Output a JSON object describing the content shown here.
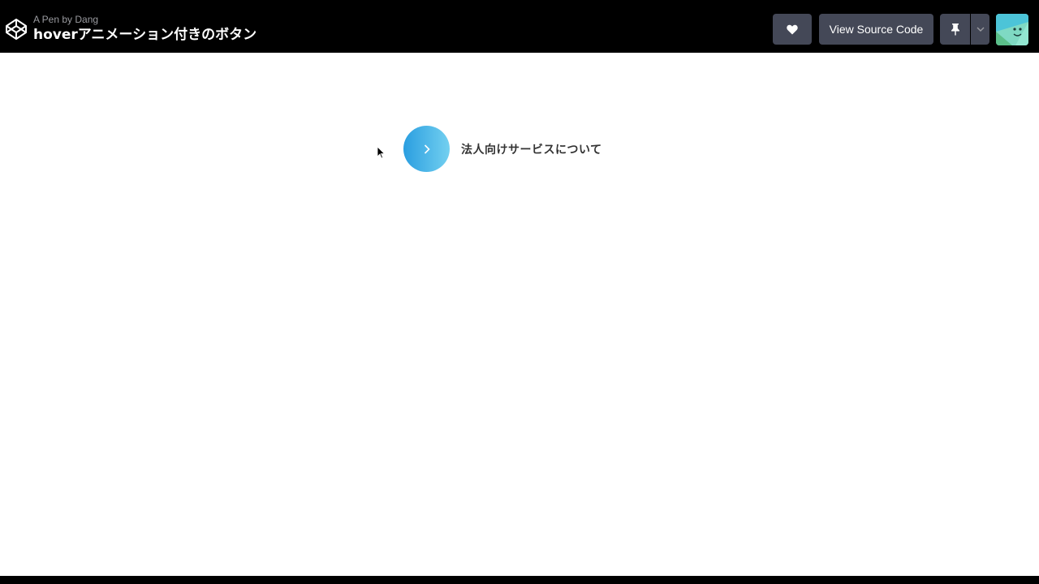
{
  "header": {
    "author_line": "A Pen by Dang",
    "title": "hoverアニメーション付きのボタン",
    "logo_icon": "codepen-cube-icon",
    "heart_icon": "heart-icon",
    "view_source_label": "View Source Code",
    "pin_icon": "pin-icon",
    "caret_icon": "chevron-down-icon",
    "avatar_icon": "user-avatar"
  },
  "main": {
    "cta_label": "法人向けサービスについて",
    "cta_icon": "chevron-right-icon",
    "gradient": [
      "#2a9ee0",
      "#73d0f0"
    ]
  },
  "colors": {
    "topbar": "#000000",
    "button_bg": "#444857",
    "text_dark": "#333333"
  }
}
